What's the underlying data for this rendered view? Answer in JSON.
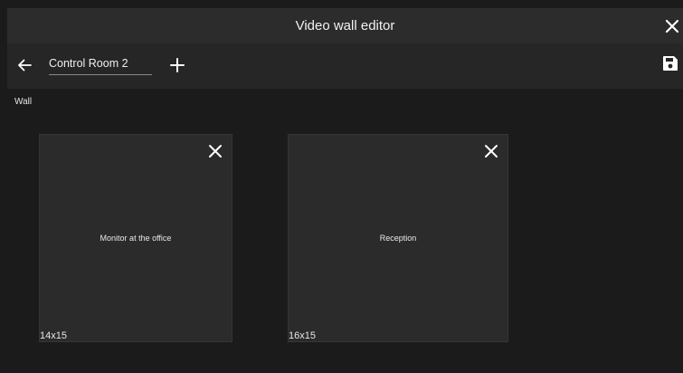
{
  "window": {
    "title": "Video wall editor",
    "close_icon": "close-icon"
  },
  "toolbar": {
    "back_icon": "arrow-left-icon",
    "wall_name_value": "Control Room 2",
    "add_icon": "plus-icon",
    "save_icon": "floppy-disk-icon"
  },
  "wall": {
    "label": "Wall",
    "monitors": [
      {
        "name": "Monitor at the office",
        "size": "14x15",
        "remove_icon": "close-icon"
      },
      {
        "name": "Reception",
        "size": "16x15",
        "remove_icon": "close-icon"
      }
    ]
  },
  "colors": {
    "background": "#1b1b1b",
    "title_bar": "#2c2c2c",
    "toolbar": "#262626",
    "tile": "#2b2b2b",
    "text": "#ffffff"
  }
}
